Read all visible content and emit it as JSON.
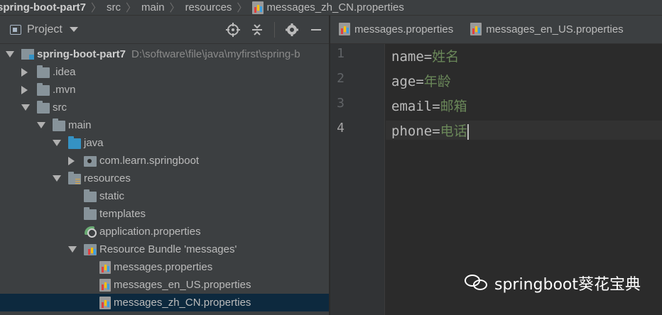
{
  "breadcrumb": {
    "items": [
      "spring-boot-part7",
      "src",
      "main",
      "resources",
      "messages_zh_CN.properties"
    ]
  },
  "panel": {
    "title": "Project",
    "tools": [
      "target-icon",
      "collapse-icon",
      "gear-icon",
      "minimize-icon"
    ]
  },
  "tree": [
    {
      "label": "spring-boot-part7",
      "path": "D:\\software\\file\\java\\myfirst\\spring-b",
      "icon": "module-icon",
      "expanded": true
    },
    {
      "label": ".idea",
      "icon": "folder-icon",
      "expanded": false
    },
    {
      "label": ".mvn",
      "icon": "folder-icon",
      "expanded": false
    },
    {
      "label": "src",
      "icon": "folder-icon",
      "expanded": true
    },
    {
      "label": "main",
      "icon": "folder-icon",
      "expanded": true
    },
    {
      "label": "java",
      "icon": "source-folder-icon",
      "expanded": true
    },
    {
      "label": "com.learn.springboot",
      "icon": "package-icon",
      "expanded": false
    },
    {
      "label": "resources",
      "icon": "resources-folder-icon",
      "expanded": true
    },
    {
      "label": "static",
      "icon": "folder-icon"
    },
    {
      "label": "templates",
      "icon": "folder-icon"
    },
    {
      "label": "application.properties",
      "icon": "spring-properties-icon"
    },
    {
      "label": "Resource Bundle 'messages'",
      "icon": "resource-bundle-icon",
      "expanded": true
    },
    {
      "label": "messages.properties",
      "icon": "properties-icon"
    },
    {
      "label": "messages_en_US.properties",
      "icon": "properties-icon"
    },
    {
      "label": "messages_zh_CN.properties",
      "icon": "properties-icon",
      "selected": true
    }
  ],
  "editor": {
    "tabs": [
      "messages.properties",
      "messages_en_US.properties"
    ],
    "lines": [
      {
        "num": "1",
        "key": "name",
        "eq": "=",
        "value": "姓名"
      },
      {
        "num": "2",
        "key": "age",
        "eq": "=",
        "value": "年龄"
      },
      {
        "num": "3",
        "key": "email",
        "eq": "=",
        "value": "邮箱"
      },
      {
        "num": "4",
        "key": "phone",
        "eq": "=",
        "value": "电话"
      }
    ]
  },
  "watermark": {
    "text": "springboot葵花宝典"
  },
  "colors": {
    "selection": "#0d293e",
    "value_text": "#6a8759",
    "panel_bg": "#3c3f41",
    "editor_bg": "#2b2b2b"
  }
}
